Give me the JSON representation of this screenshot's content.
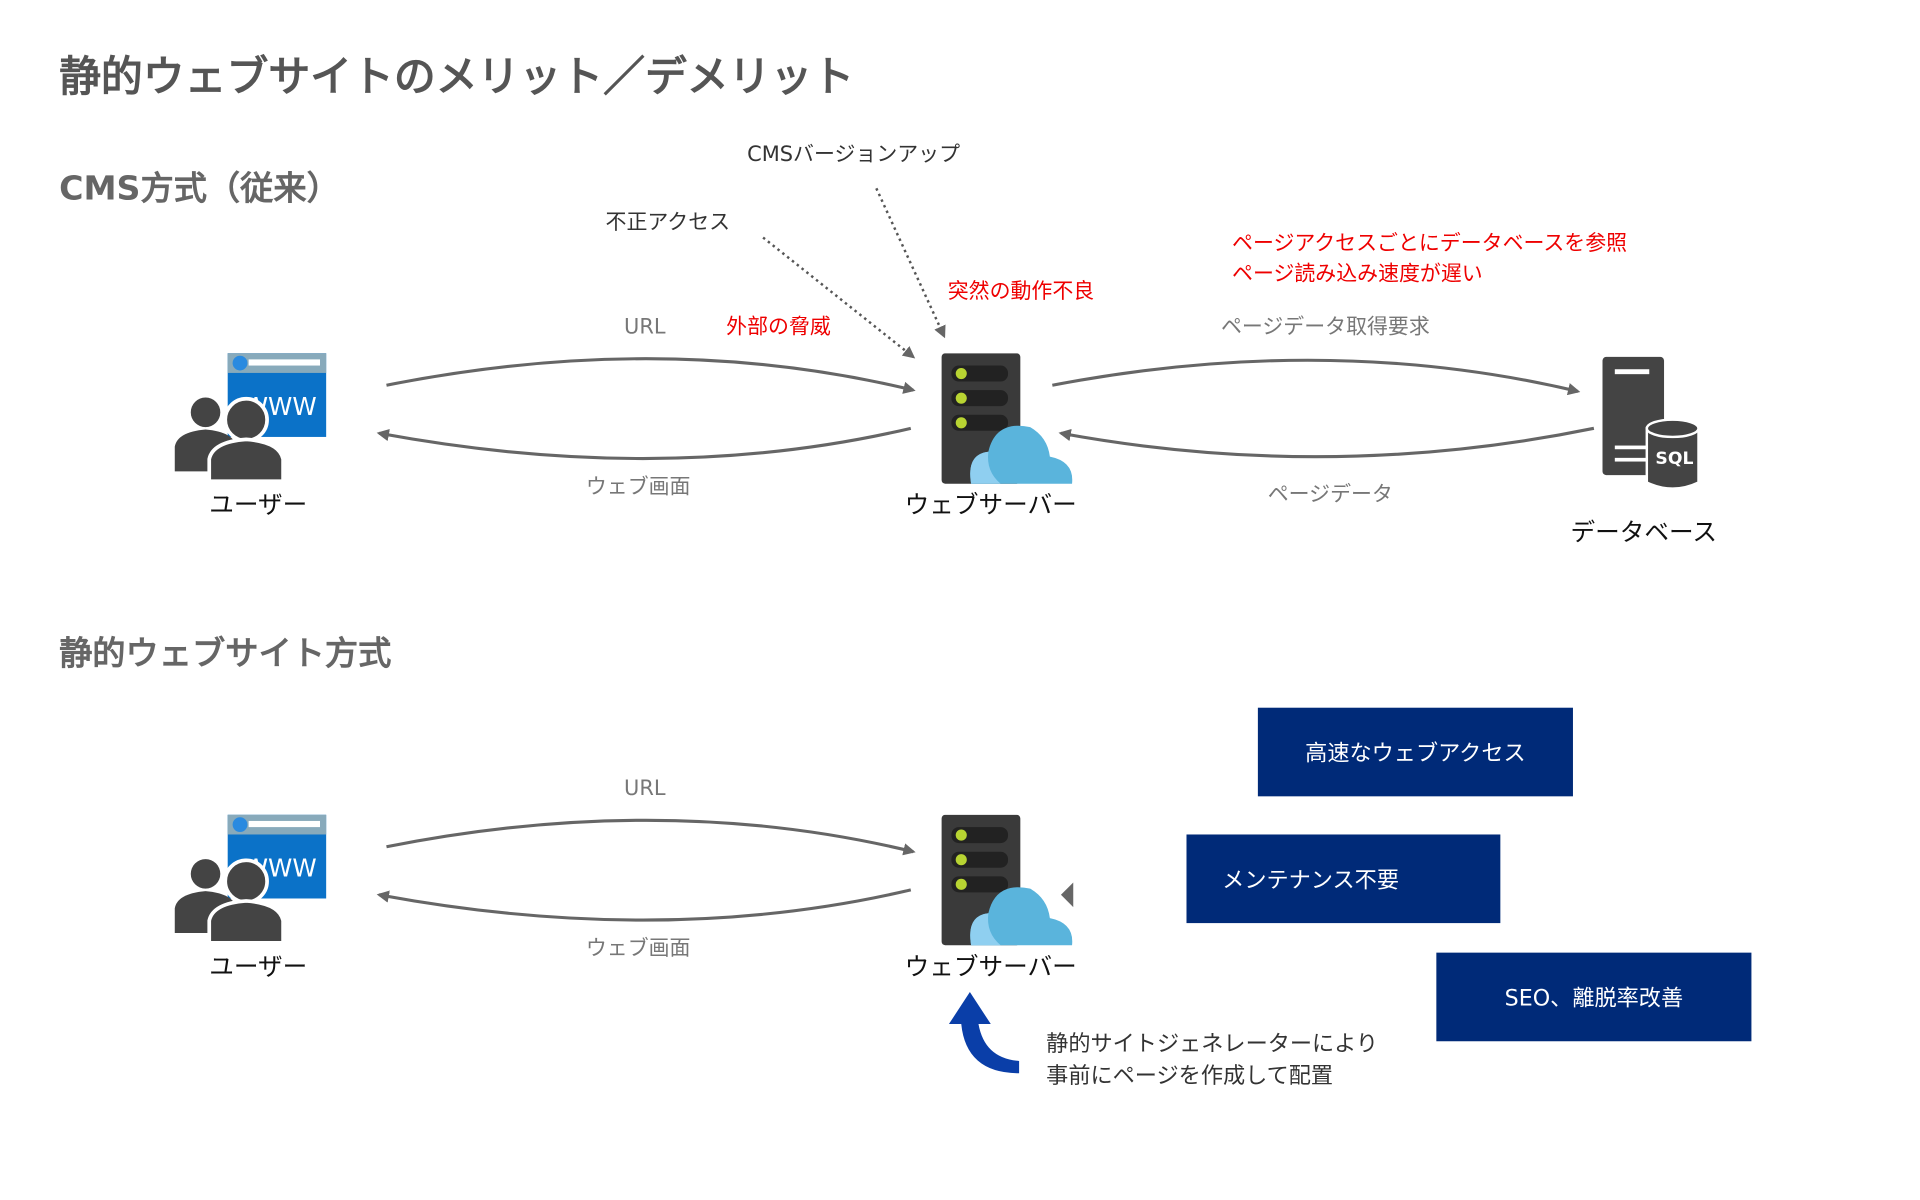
{
  "title": "静的ウェブサイトのメリット／デメリット",
  "cms": {
    "heading": "CMS方式（従来）",
    "labels": {
      "version_up": "CMSバージョンアップ",
      "unauthorized": "不正アクセス",
      "malfunction": "突然の動作不良",
      "external_threat": "外部の脅威",
      "url": "URL",
      "web_screen": "ウェブ画面",
      "db_request": "ページデータ取得要求",
      "page_data": "ページデータ",
      "db_note_1": "ページアクセスごとにデータベースを参照",
      "db_note_2": "ページ読み込み速度が遅い"
    },
    "nodes": {
      "user": "ユーザー",
      "server": "ウェブサーバー",
      "database": "データベース"
    }
  },
  "static": {
    "heading": "静的ウェブサイト方式",
    "labels": {
      "url": "URL",
      "web_screen": "ウェブ画面"
    },
    "nodes": {
      "user": "ユーザー",
      "server": "ウェブサーバー"
    },
    "benefits": [
      "高速なウェブアクセス",
      "メンテナンス不要",
      "SEO、離脱率改善"
    ],
    "generator_note": [
      "静的サイトジェネレーターにより",
      "事前にページを作成して配置"
    ]
  },
  "icons": {
    "www_text": "WWW",
    "sql_text": "SQL"
  },
  "colors": {
    "accent_red": "#ee0000",
    "box_navy": "#002a78",
    "cloud_blue": "#5ab4dc",
    "arrow_blue": "#0a3ea8"
  }
}
